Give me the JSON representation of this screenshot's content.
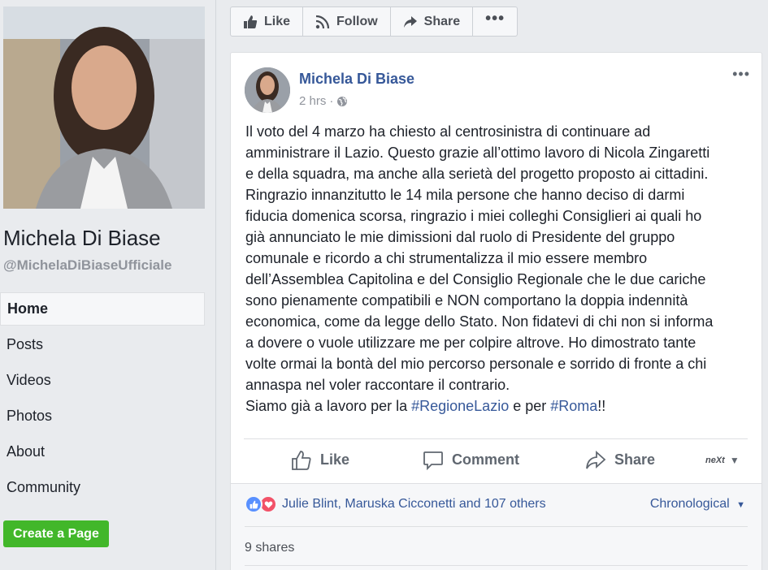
{
  "sidebar": {
    "page_name": "Michela Di Biase",
    "page_handle": "@MichelaDiBiaseUfficiale",
    "nav": [
      {
        "label": "Home"
      },
      {
        "label": "Posts"
      },
      {
        "label": "Videos"
      },
      {
        "label": "Photos"
      },
      {
        "label": "About"
      },
      {
        "label": "Community"
      }
    ],
    "create_page": "Create a Page"
  },
  "actionbar": {
    "like": "Like",
    "follow": "Follow",
    "share": "Share",
    "more": "•••"
  },
  "post": {
    "author": "Michela Di Biase",
    "time": "2 hrs",
    "separator": "·",
    "more": "•••",
    "lines": [
      "Il voto del 4 marzo ha chiesto al centrosinistra di continuare ad",
      "amministrare il Lazio. Questo grazie all’ottimo lavoro di Nicola Zingaretti",
      "e della squadra, ma anche alla serietà del progetto proposto ai cittadini.",
      "Ringrazio innanzitutto le 14 mila persone che hanno deciso di darmi",
      "fiducia domenica scorsa, ringrazio i miei colleghi Consiglieri ai quali ho",
      "già annunciato le mie dimissioni dal ruolo di Presidente del gruppo",
      "comunale e ricordo a chi strumentalizza il mio essere membro",
      "dell’Assemblea Capitolina e del Consiglio Regionale che le due cariche",
      "sono pienamente compatibili e NON comportano la doppia indennità",
      "economica, come da legge dello Stato. Non fidatevi di chi non si informa",
      "a dovere o vuole utilizzare me per colpire altrove. Ho dimostrato tante",
      "volte ormai la bontà del mio percorso personale e sorrido di fronte a chi",
      "annaspa nel voler raccontare il contrario."
    ],
    "last_line_prefix": "Siamo già a lavoro per la ",
    "hashtag1": "#RegioneLazio",
    "last_line_middle": " e per ",
    "hashtag2": "#Roma",
    "last_line_suffix": "!!",
    "actions": {
      "like": "Like",
      "comment": "Comment",
      "share": "Share",
      "next": "neXt"
    },
    "reactions_text": "Julie Blint, Maruska Cicconetti and 107 others",
    "ordering": "Chronological",
    "shares": "9 shares"
  },
  "colors": {
    "link": "#365899",
    "green_button": "#42b72a",
    "background": "#e9ebee"
  }
}
